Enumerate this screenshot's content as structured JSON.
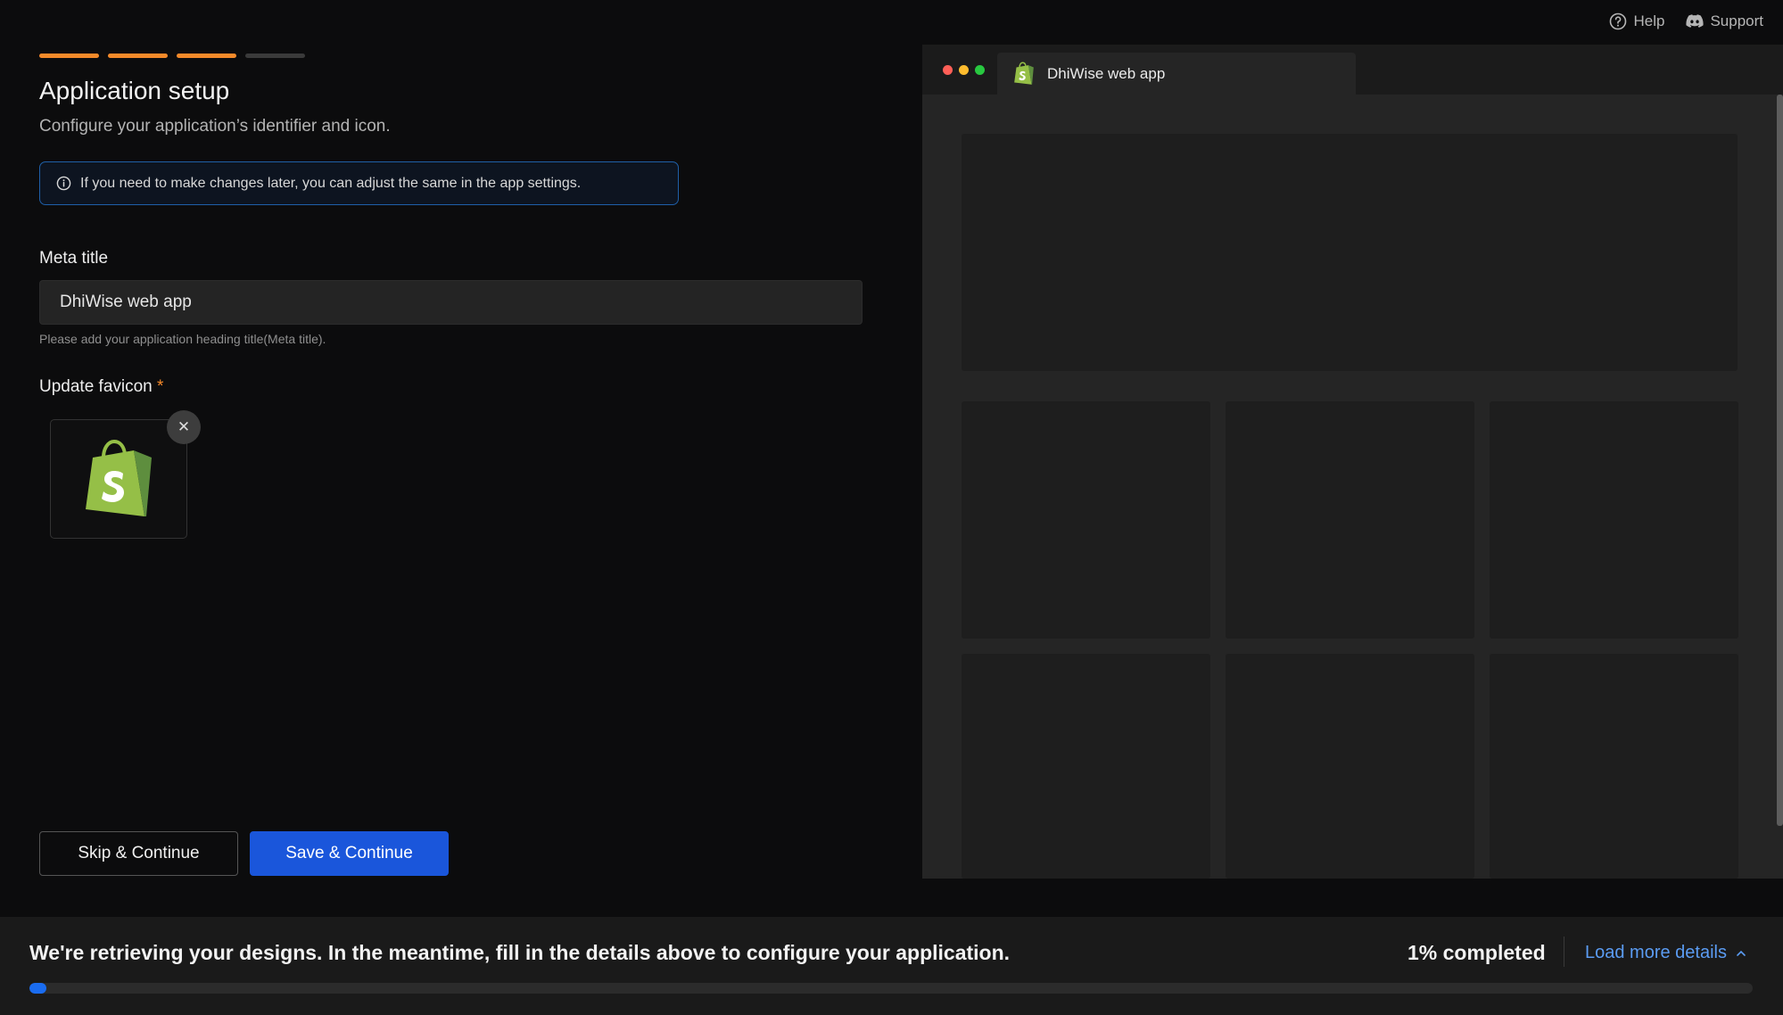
{
  "top_links": {
    "help": "Help",
    "support": "Support"
  },
  "stepper": {
    "total_steps": 4,
    "completed_steps": 3,
    "active_color": "#f58a2a",
    "inactive_color": "#3a3a3a"
  },
  "page": {
    "title": "Application setup",
    "subtitle": "Configure your application’s identifier and icon.",
    "info": "If you need to make changes later, you can adjust the same in the app settings."
  },
  "meta_title": {
    "label": "Meta title",
    "value": "DhiWise web app",
    "helper": "Please add your application heading title(Meta title)."
  },
  "favicon": {
    "label": "Update favicon",
    "required_mark": "*",
    "remove_glyph": "✕",
    "icon": "shopify-bag-icon"
  },
  "buttons": {
    "skip": "Skip & Continue",
    "save": "Save & Continue"
  },
  "preview": {
    "tab_title": "DhiWise web app",
    "dot_colors": [
      "#ff5f57",
      "#febc2e",
      "#28c840"
    ]
  },
  "bottom": {
    "message": "We're retrieving your designs. In the meantime, fill in the details above to configure your application.",
    "progress_label": "1% completed",
    "progress_value": 1,
    "load_more": "Load more details"
  },
  "colors": {
    "primary": "#1a56db",
    "accent": "#f58a2a",
    "link": "#5b9cf3"
  }
}
